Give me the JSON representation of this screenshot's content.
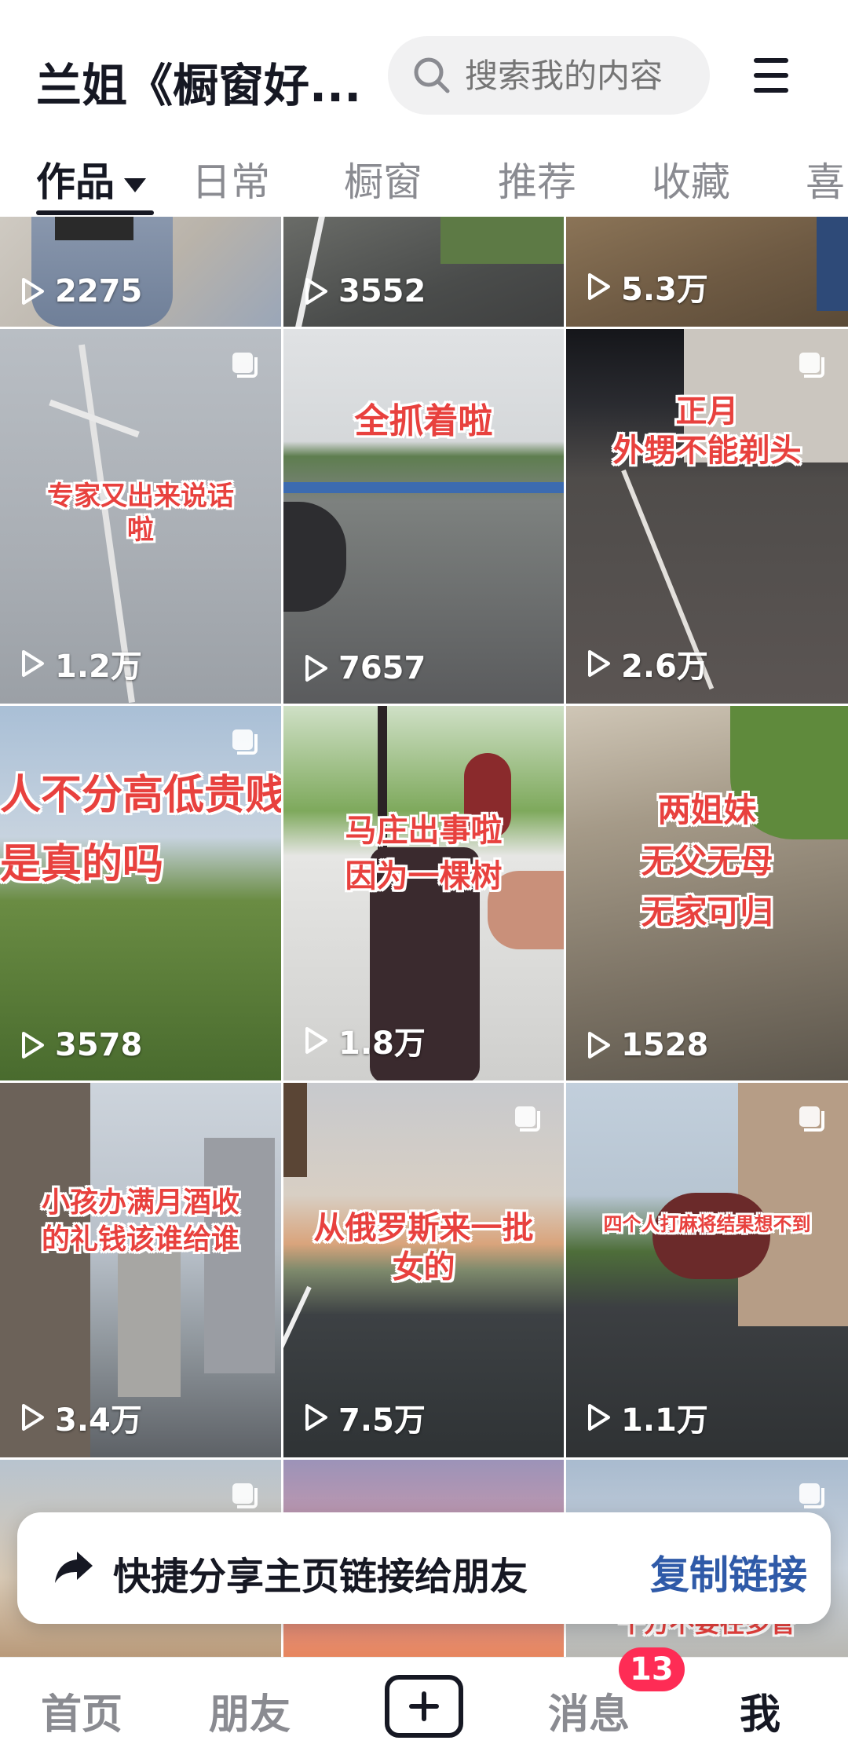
{
  "header": {
    "title": "兰姐《橱窗好...",
    "search_placeholder": "搜索我的内容"
  },
  "tabs": [
    {
      "label": "作品",
      "active": true
    },
    {
      "label": "日常",
      "active": false
    },
    {
      "label": "橱窗",
      "active": false
    },
    {
      "label": "推荐",
      "active": false
    },
    {
      "label": "收藏",
      "active": false
    },
    {
      "label": "喜",
      "active": false
    }
  ],
  "videos": [
    {
      "views": "2275",
      "text": "",
      "multi": false
    },
    {
      "views": "3552",
      "text": "",
      "multi": false
    },
    {
      "views": "5.3万",
      "text": "",
      "multi": false
    },
    {
      "views": "1.2万",
      "text": "专家又出来说话\n啦",
      "multi": true
    },
    {
      "views": "7657",
      "text": "全抓着啦",
      "multi": false
    },
    {
      "views": "2.6万",
      "text": "正月\n外甥不能剃头",
      "multi": true
    },
    {
      "views": "3578",
      "text": "人不分高低贵贱\n是真的吗",
      "multi": true
    },
    {
      "views": "1.8万",
      "text": "马庄出事啦\n因为一棵树",
      "multi": false
    },
    {
      "views": "1528",
      "text": "两姐妹\n无父无母\n无家可归",
      "multi": false
    },
    {
      "views": "3.4万",
      "text": "小孩办满月酒收\n的礼钱该谁给谁",
      "multi": false
    },
    {
      "views": "7.5万",
      "text": "从俄罗斯来一批\n女的",
      "multi": true
    },
    {
      "views": "1.1万",
      "text": "四个人打麻将结果想不到",
      "multi": true
    },
    {
      "views": "",
      "text": "",
      "multi": true
    },
    {
      "views": "",
      "text": "",
      "multi": false
    },
    {
      "views": "",
      "text": "千万不要在多管",
      "multi": true
    }
  ],
  "share": {
    "text": "快捷分享主页链接给朋友",
    "link_label": "复制链接"
  },
  "nav": {
    "home": "首页",
    "friends": "朋友",
    "messages": "消息",
    "me": "我",
    "badge": "13"
  },
  "colors": {
    "accent_link": "#2f5aa8",
    "badge": "#fe2c55",
    "overlay_text": "#e8413e"
  }
}
